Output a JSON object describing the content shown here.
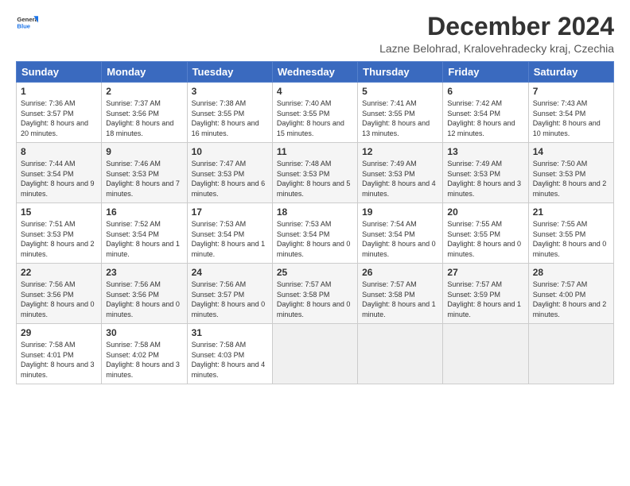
{
  "logo": {
    "line1": "General",
    "line2": "Blue"
  },
  "title": "December 2024",
  "subtitle": "Lazne Belohrad, Kralovehradecky kraj, Czechia",
  "weekdays": [
    "Sunday",
    "Monday",
    "Tuesday",
    "Wednesday",
    "Thursday",
    "Friday",
    "Saturday"
  ],
  "weeks": [
    [
      {
        "day": "1",
        "sunrise": "Sunrise: 7:36 AM",
        "sunset": "Sunset: 3:57 PM",
        "daylight": "Daylight: 8 hours and 20 minutes."
      },
      {
        "day": "2",
        "sunrise": "Sunrise: 7:37 AM",
        "sunset": "Sunset: 3:56 PM",
        "daylight": "Daylight: 8 hours and 18 minutes."
      },
      {
        "day": "3",
        "sunrise": "Sunrise: 7:38 AM",
        "sunset": "Sunset: 3:55 PM",
        "daylight": "Daylight: 8 hours and 16 minutes."
      },
      {
        "day": "4",
        "sunrise": "Sunrise: 7:40 AM",
        "sunset": "Sunset: 3:55 PM",
        "daylight": "Daylight: 8 hours and 15 minutes."
      },
      {
        "day": "5",
        "sunrise": "Sunrise: 7:41 AM",
        "sunset": "Sunset: 3:55 PM",
        "daylight": "Daylight: 8 hours and 13 minutes."
      },
      {
        "day": "6",
        "sunrise": "Sunrise: 7:42 AM",
        "sunset": "Sunset: 3:54 PM",
        "daylight": "Daylight: 8 hours and 12 minutes."
      },
      {
        "day": "7",
        "sunrise": "Sunrise: 7:43 AM",
        "sunset": "Sunset: 3:54 PM",
        "daylight": "Daylight: 8 hours and 10 minutes."
      }
    ],
    [
      {
        "day": "8",
        "sunrise": "Sunrise: 7:44 AM",
        "sunset": "Sunset: 3:54 PM",
        "daylight": "Daylight: 8 hours and 9 minutes."
      },
      {
        "day": "9",
        "sunrise": "Sunrise: 7:46 AM",
        "sunset": "Sunset: 3:53 PM",
        "daylight": "Daylight: 8 hours and 7 minutes."
      },
      {
        "day": "10",
        "sunrise": "Sunrise: 7:47 AM",
        "sunset": "Sunset: 3:53 PM",
        "daylight": "Daylight: 8 hours and 6 minutes."
      },
      {
        "day": "11",
        "sunrise": "Sunrise: 7:48 AM",
        "sunset": "Sunset: 3:53 PM",
        "daylight": "Daylight: 8 hours and 5 minutes."
      },
      {
        "day": "12",
        "sunrise": "Sunrise: 7:49 AM",
        "sunset": "Sunset: 3:53 PM",
        "daylight": "Daylight: 8 hours and 4 minutes."
      },
      {
        "day": "13",
        "sunrise": "Sunrise: 7:49 AM",
        "sunset": "Sunset: 3:53 PM",
        "daylight": "Daylight: 8 hours and 3 minutes."
      },
      {
        "day": "14",
        "sunrise": "Sunrise: 7:50 AM",
        "sunset": "Sunset: 3:53 PM",
        "daylight": "Daylight: 8 hours and 2 minutes."
      }
    ],
    [
      {
        "day": "15",
        "sunrise": "Sunrise: 7:51 AM",
        "sunset": "Sunset: 3:53 PM",
        "daylight": "Daylight: 8 hours and 2 minutes."
      },
      {
        "day": "16",
        "sunrise": "Sunrise: 7:52 AM",
        "sunset": "Sunset: 3:54 PM",
        "daylight": "Daylight: 8 hours and 1 minute."
      },
      {
        "day": "17",
        "sunrise": "Sunrise: 7:53 AM",
        "sunset": "Sunset: 3:54 PM",
        "daylight": "Daylight: 8 hours and 1 minute."
      },
      {
        "day": "18",
        "sunrise": "Sunrise: 7:53 AM",
        "sunset": "Sunset: 3:54 PM",
        "daylight": "Daylight: 8 hours and 0 minutes."
      },
      {
        "day": "19",
        "sunrise": "Sunrise: 7:54 AM",
        "sunset": "Sunset: 3:54 PM",
        "daylight": "Daylight: 8 hours and 0 minutes."
      },
      {
        "day": "20",
        "sunrise": "Sunrise: 7:55 AM",
        "sunset": "Sunset: 3:55 PM",
        "daylight": "Daylight: 8 hours and 0 minutes."
      },
      {
        "day": "21",
        "sunrise": "Sunrise: 7:55 AM",
        "sunset": "Sunset: 3:55 PM",
        "daylight": "Daylight: 8 hours and 0 minutes."
      }
    ],
    [
      {
        "day": "22",
        "sunrise": "Sunrise: 7:56 AM",
        "sunset": "Sunset: 3:56 PM",
        "daylight": "Daylight: 8 hours and 0 minutes."
      },
      {
        "day": "23",
        "sunrise": "Sunrise: 7:56 AM",
        "sunset": "Sunset: 3:56 PM",
        "daylight": "Daylight: 8 hours and 0 minutes."
      },
      {
        "day": "24",
        "sunrise": "Sunrise: 7:56 AM",
        "sunset": "Sunset: 3:57 PM",
        "daylight": "Daylight: 8 hours and 0 minutes."
      },
      {
        "day": "25",
        "sunrise": "Sunrise: 7:57 AM",
        "sunset": "Sunset: 3:58 PM",
        "daylight": "Daylight: 8 hours and 0 minutes."
      },
      {
        "day": "26",
        "sunrise": "Sunrise: 7:57 AM",
        "sunset": "Sunset: 3:58 PM",
        "daylight": "Daylight: 8 hours and 1 minute."
      },
      {
        "day": "27",
        "sunrise": "Sunrise: 7:57 AM",
        "sunset": "Sunset: 3:59 PM",
        "daylight": "Daylight: 8 hours and 1 minute."
      },
      {
        "day": "28",
        "sunrise": "Sunrise: 7:57 AM",
        "sunset": "Sunset: 4:00 PM",
        "daylight": "Daylight: 8 hours and 2 minutes."
      }
    ],
    [
      {
        "day": "29",
        "sunrise": "Sunrise: 7:58 AM",
        "sunset": "Sunset: 4:01 PM",
        "daylight": "Daylight: 8 hours and 3 minutes."
      },
      {
        "day": "30",
        "sunrise": "Sunrise: 7:58 AM",
        "sunset": "Sunset: 4:02 PM",
        "daylight": "Daylight: 8 hours and 3 minutes."
      },
      {
        "day": "31",
        "sunrise": "Sunrise: 7:58 AM",
        "sunset": "Sunset: 4:03 PM",
        "daylight": "Daylight: 8 hours and 4 minutes."
      },
      null,
      null,
      null,
      null
    ]
  ]
}
